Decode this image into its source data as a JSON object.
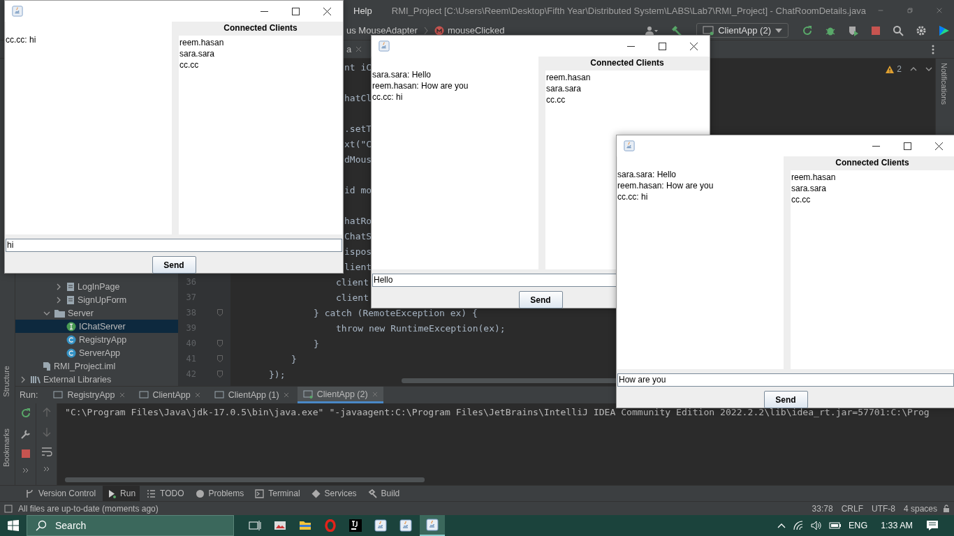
{
  "ide": {
    "menu_item": "Help",
    "title": "RMI_Project [C:\\Users\\Reem\\Desktop\\Fifth Year\\Distributed System\\LABS\\Lab7\\RMI_Project] - ChatRoomDetails.java",
    "breadcrumb": [
      "us MouseAdapter",
      "mouseClicked"
    ],
    "run_config": "ClientApp (2)",
    "editor_tab": "a",
    "warning_count": "2",
    "code_lines": [
      {
        "text": "nt iC"
      },
      {
        "text": "hatCl"
      },
      {
        "text": ".setT"
      },
      {
        "text": "xt(\"C"
      },
      {
        "text": "dMous"
      },
      {
        "text": "id mo"
      },
      {
        "text": "hatRo"
      },
      {
        "text": "ChatS"
      },
      {
        "text": "ispos"
      },
      {
        "text": "lient"
      },
      {
        "text": "client",
        "number": "36"
      },
      {
        "text": "client",
        "number": "37"
      },
      {
        "text": "} catch (RemoteException ex) {",
        "number": "38",
        "fold": true
      },
      {
        "text": "throw new RuntimeException(ex);",
        "number": "39"
      },
      {
        "text": "}",
        "number": "40",
        "fold": true
      },
      {
        "text": "}",
        "number": "41",
        "fold": true
      },
      {
        "text": "});",
        "number": "42",
        "fold": true
      }
    ],
    "tree": [
      {
        "children": [
          {
            "children": [
              {
                "children": [
                  {
                    "label": "LogInPage",
                    "kind": "form",
                    "expanded": false,
                    "selected": false
                  },
                  {
                    "label": "SignUpForm",
                    "kind": "form",
                    "expanded": false,
                    "selected": false
                  }
                ]
              },
              {
                "label": "Server",
                "kind": "folder",
                "expanded": true,
                "selected": false,
                "children": [
                  {
                    "label": "IChatServer",
                    "kind": "interface",
                    "selected": true
                  },
                  {
                    "label": "RegistryApp",
                    "kind": "class",
                    "selected": false
                  },
                  {
                    "label": "ServerApp",
                    "kind": "class",
                    "selected": false
                  }
                ]
              }
            ]
          },
          {
            "label": "RMI_Project.iml",
            "kind": "file",
            "selected": false
          }
        ]
      },
      {
        "label": "External Libraries",
        "kind": "library",
        "expanded": false,
        "selected": false
      }
    ],
    "left_tools": [
      "Structure",
      "Bookmarks"
    ],
    "right_tool": "Notifications",
    "run": {
      "label": "Run:",
      "tabs": [
        {
          "label": "RegistryApp",
          "selected": false
        },
        {
          "label": "ClientApp",
          "selected": false
        },
        {
          "label": "ClientApp (1)",
          "selected": false
        },
        {
          "label": "ClientApp (2)",
          "selected": true
        }
      ],
      "console": "\"C:\\Program Files\\Java\\jdk-17.0.5\\bin\\java.exe\" \"-javaagent:C:\\Program Files\\JetBrains\\IntelliJ IDEA Community Edition 2022.2.2\\lib\\idea_rt.jar=57701:C:\\Prog"
    },
    "tool_windows": [
      {
        "label": "Version Control",
        "selected": false
      },
      {
        "label": "Run",
        "selected": true
      },
      {
        "label": "TODO",
        "selected": false
      },
      {
        "label": "Problems",
        "selected": false
      },
      {
        "label": "Terminal",
        "selected": false
      },
      {
        "label": "Services",
        "selected": false
      },
      {
        "label": "Build",
        "selected": false
      }
    ],
    "status": {
      "message": "All files are up-to-date (moments ago)",
      "position": "33:78",
      "line_separator": "CRLF",
      "encoding": "UTF-8",
      "indent": "4 spaces"
    }
  },
  "chat_windows": [
    {
      "messages": [
        "cc.cc: hi"
      ],
      "clients_title": "Connected Clients",
      "clients": [
        "reem.hasan",
        "sara.sara",
        "cc.cc"
      ],
      "input": "hi",
      "send": "Send"
    },
    {
      "messages": [
        "sara.sara: Hello",
        "reem.hasan: How are you",
        "cc.cc: hi"
      ],
      "clients_title": "Connected Clients",
      "clients": [
        "reem.hasan",
        "sara.sara",
        "cc.cc"
      ],
      "input": "Hello",
      "send": "Send"
    },
    {
      "messages": [
        "sara.sara: Hello",
        "reem.hasan: How are you",
        "cc.cc: hi"
      ],
      "clients_title": "Connected Clients",
      "clients": [
        "reem.hasan",
        "sara.sara",
        "cc.cc"
      ],
      "input": "How are you",
      "send": "Send"
    }
  ],
  "taskbar": {
    "search": "Search",
    "language": "ENG",
    "time": "1:33 AM"
  }
}
